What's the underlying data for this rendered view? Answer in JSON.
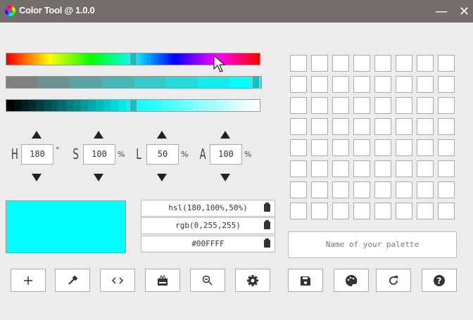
{
  "window": {
    "title": "Color Tool @ 1.0.0",
    "minimize": "—",
    "close": "✕"
  },
  "controls": [
    {
      "label": "H",
      "value": "180",
      "unit": "°"
    },
    {
      "label": "S",
      "value": "100",
      "unit": "%"
    },
    {
      "label": "L",
      "value": "50",
      "unit": "%"
    },
    {
      "label": "A",
      "value": "100",
      "unit": "%"
    }
  ],
  "sliders": {
    "hue": 180,
    "saturation": 100,
    "lightness": 50
  },
  "preview_color": "#00FFFF",
  "codes": [
    "hsl(180,100%,50%)",
    "rgb(0,255,255)",
    "#00FFFF"
  ],
  "palette_name_placeholder": "Name of your palette",
  "buttons": [
    "add",
    "eyedropper",
    "code",
    "gift",
    "zoom-out",
    "settings",
    "save",
    "palette",
    "refresh",
    "help"
  ]
}
